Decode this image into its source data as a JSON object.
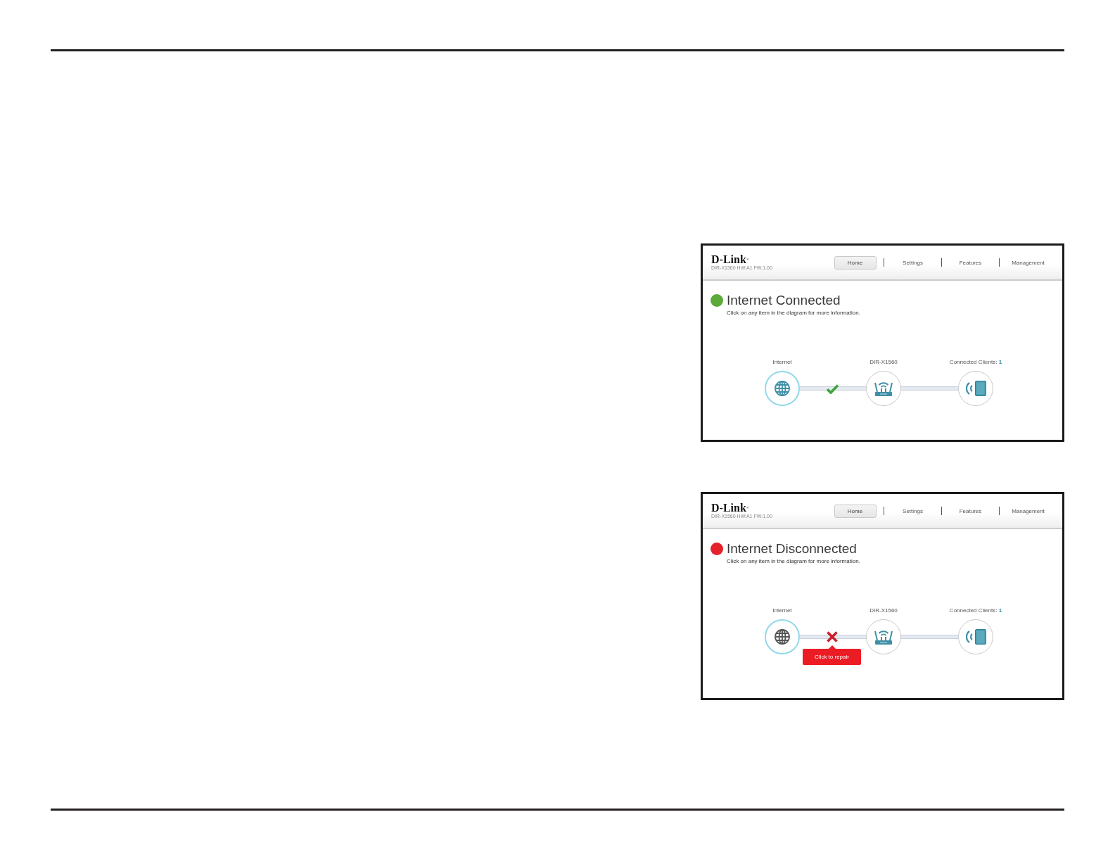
{
  "screenshots": [
    {
      "connected": true,
      "header": {
        "logo": "D-Link$^{®}$",
        "model": "DIR-X1560 HW:A1 FW:1.00",
        "tabs": [
          {
            "label": "Home",
            "selected": true
          },
          {
            "label": "Settings",
            "selected": false
          },
          {
            "label": "Features",
            "selected": false
          },
          {
            "label": "Management",
            "selected": false
          }
        ]
      },
      "status": {
        "color": "#5aab37",
        "title": "Internet Connected",
        "hint": "Click on any item in the diagram for more information."
      },
      "nodes": [
        {
          "kind": "globe",
          "label": "Internet",
          "selected": true
        },
        {
          "kind": "router",
          "label": "DIR-X1560",
          "selected": false
        },
        {
          "kind": "clients",
          "label": "Connected Clients:",
          "count": "1",
          "selected": false
        }
      ]
    },
    {
      "connected": false,
      "header": {
        "logo": "D-Link$^{®}$",
        "model": "DIR-X1560 HW:A1 FW:1.00",
        "tabs": [
          {
            "label": "Home",
            "selected": true
          },
          {
            "label": "Settings",
            "selected": false
          },
          {
            "label": "Features",
            "selected": false
          },
          {
            "label": "Management",
            "selected": false
          }
        ]
      },
      "status": {
        "color": "#e5212b",
        "title": "Internet Disconnected",
        "hint": "Click on any item in the diagram for more information."
      },
      "nodes": [
        {
          "kind": "globe",
          "label": "Internet",
          "selected": true
        },
        {
          "kind": "router",
          "label": "DIR-X1560",
          "selected": false
        },
        {
          "kind": "clients",
          "label": "Connected Clients:",
          "count": "1",
          "selected": false
        }
      ],
      "repair_tooltip": "Click to repair"
    }
  ]
}
